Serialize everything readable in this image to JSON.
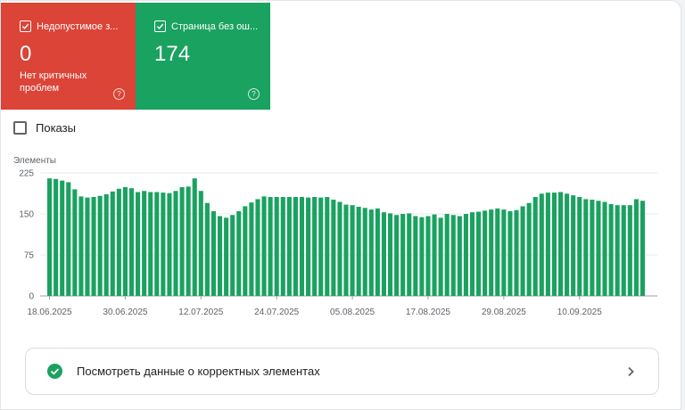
{
  "cards": {
    "errors": {
      "title": "Недопустимое з...",
      "value": "0",
      "subtitle": "Нет критичных проблем",
      "color": "#db4437",
      "icon": "checkbox-checked-icon"
    },
    "valid": {
      "title": "Страница без ош...",
      "value": "174",
      "subtitle": "",
      "color": "#1aa260",
      "icon": "checkbox-checked-icon"
    }
  },
  "impressions_label": "Показы",
  "valid_link_label": "Посмотреть данные о корректных элементах",
  "chart_data": {
    "type": "bar",
    "ylabel": "Элементы",
    "ylim": [
      0,
      225
    ],
    "yticks": [
      0,
      75,
      150,
      225
    ],
    "tick_labels": [
      "18.06.2025",
      "30.06.2025",
      "12.07.2025",
      "24.07.2025",
      "05.08.2025",
      "17.08.2025",
      "29.08.2025",
      "10.09.2025"
    ],
    "series": [
      {
        "color": "#1aa260",
        "values": [
          215,
          214,
          211,
          208,
          195,
          182,
          180,
          181,
          183,
          186,
          191,
          196,
          199,
          197,
          190,
          192,
          190,
          190,
          189,
          188,
          192,
          199,
          200,
          215,
          192,
          170,
          155,
          146,
          143,
          148,
          155,
          164,
          171,
          177,
          182,
          181,
          181,
          181,
          181,
          181,
          181,
          180,
          181,
          180,
          181,
          176,
          172,
          167,
          166,
          163,
          161,
          158,
          160,
          153,
          151,
          148,
          150,
          151,
          146,
          144,
          146,
          149,
          143,
          150,
          148,
          146,
          150,
          153,
          154,
          156,
          158,
          160,
          158,
          155,
          157,
          164,
          170,
          181,
          187,
          189,
          189,
          190,
          187,
          184,
          181,
          177,
          176,
          174,
          172,
          168,
          166,
          166,
          166,
          177,
          174
        ]
      }
    ],
    "grid": true
  }
}
